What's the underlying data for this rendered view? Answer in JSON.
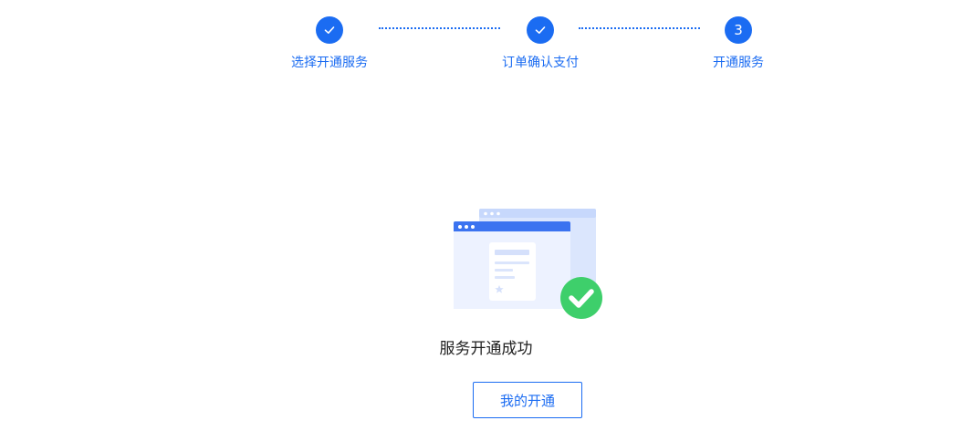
{
  "steps": [
    {
      "label": "选择开通服务",
      "status": "done"
    },
    {
      "label": "订单确认支付",
      "status": "done"
    },
    {
      "label": "开通服务",
      "status": "current",
      "number": "3"
    }
  ],
  "result": {
    "title": "服务开通成功",
    "button_label": "我的开通"
  },
  "colors": {
    "primary": "#1b6cf2",
    "success": "#3ecf6b",
    "illustration_light": "#e8efff",
    "illustration_mid": "#cfdcff",
    "illustration_bar": "#3b73f0"
  },
  "icons": {
    "done": "check-icon",
    "success": "success-check-icon",
    "illustration": "browser-document-icon"
  }
}
